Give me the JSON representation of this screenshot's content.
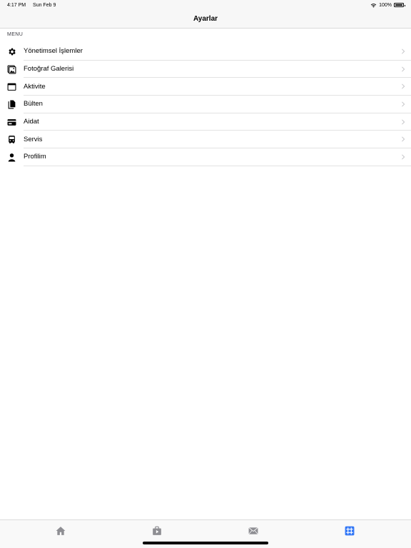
{
  "status_bar": {
    "time": "4:17 PM",
    "date": "Sun Feb 9",
    "battery": "100%"
  },
  "navbar": {
    "title": "Ayarlar"
  },
  "section": {
    "header": "MENU"
  },
  "menu": {
    "items": [
      {
        "label": "Yönetimsel İşlemler",
        "icon": "gear-icon"
      },
      {
        "label": "Fotoğraf Galerisi",
        "icon": "photo-gallery-icon"
      },
      {
        "label": "Aktivite",
        "icon": "calendar-icon"
      },
      {
        "label": "Bülten",
        "icon": "documents-icon"
      },
      {
        "label": "Aidat",
        "icon": "credit-card-icon"
      },
      {
        "label": "Servis",
        "icon": "bus-icon"
      },
      {
        "label": "Profilim",
        "icon": "person-icon"
      }
    ]
  },
  "tab_bar": {
    "tabs": [
      {
        "icon": "home-icon",
        "selected": false
      },
      {
        "icon": "video-bag-icon",
        "selected": false
      },
      {
        "icon": "mail-icon",
        "selected": false
      },
      {
        "icon": "grid-icon",
        "selected": true
      }
    ],
    "selected_color": "#3478f6",
    "unselected_color": "#8e8e93"
  }
}
